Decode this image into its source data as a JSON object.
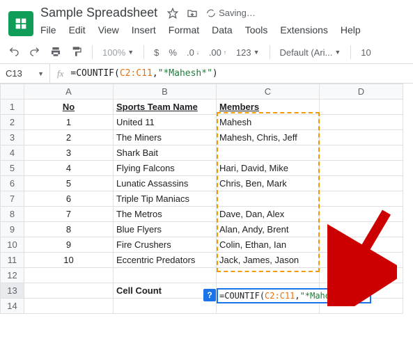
{
  "doc": {
    "title": "Sample Spreadsheet",
    "saving": "Saving…"
  },
  "menus": [
    "File",
    "Edit",
    "View",
    "Insert",
    "Format",
    "Data",
    "Tools",
    "Extensions",
    "Help"
  ],
  "toolbar": {
    "zoom": "100%",
    "font": "Default (Ari...",
    "fontsize": "10"
  },
  "cellRef": "C13",
  "formula": {
    "eq": "=",
    "fn": "COUNTIF",
    "range": "C2:C11",
    "arg": "\"*Mahesh*\""
  },
  "columns": [
    "A",
    "B",
    "C",
    "D"
  ],
  "headers": {
    "A": "No",
    "B": "Sports Team Name",
    "C": "Members"
  },
  "rows": [
    {
      "n": "1",
      "a": "1",
      "b": "United 11",
      "c": "Mahesh"
    },
    {
      "n": "2",
      "a": "2",
      "b": "The Miners",
      "c": "Mahesh, Chris, Jeff"
    },
    {
      "n": "3",
      "a": "3",
      "b": "Shark Bait",
      "c": ""
    },
    {
      "n": "4",
      "a": "4",
      "b": "Flying Falcons",
      "c": "Hari, David, Mike"
    },
    {
      "n": "5",
      "a": "5",
      "b": "Lunatic Assassins",
      "c": "Chris, Ben, Mark"
    },
    {
      "n": "6",
      "a": "6",
      "b": "Triple Tip Maniacs",
      "c": ""
    },
    {
      "n": "7",
      "a": "7",
      "b": "The Metros",
      "c": "Dave, Dan, Alex"
    },
    {
      "n": "8",
      "a": "8",
      "b": "Blue Flyers",
      "c": "Alan, Andy, Brent"
    },
    {
      "n": "9",
      "a": "9",
      "b": "Fire Crushers",
      "c": "Colin, Ethan, Ian"
    },
    {
      "n": "10",
      "a": "10",
      "b": "Eccentric Predators",
      "c": "Jack, James, Jason"
    }
  ],
  "cellCountLabel": "Cell Count",
  "helpMark": "?"
}
